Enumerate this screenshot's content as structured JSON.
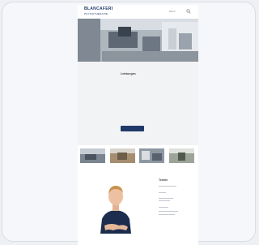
{
  "header": {
    "logo_main": "BLANCAFERI",
    "logo_sub": "PHYSIOTHERAPIE",
    "nav_label": "Menü"
  },
  "treatments": {
    "title": "Leistungen",
    "items": [
      "",
      "",
      "",
      "",
      "",
      "",
      ""
    ],
    "button_label": ""
  },
  "gallery": {
    "images": [
      "clinic-photo-1",
      "clinic-photo-2",
      "clinic-photo-3",
      "clinic-photo-4"
    ]
  },
  "contact": {
    "heading": "Termin",
    "portrait": "therapist-portrait"
  },
  "colors": {
    "brand": "#1f3a68",
    "section_bg": "#f2f3f4",
    "card_bg": "#f5f7fa"
  }
}
